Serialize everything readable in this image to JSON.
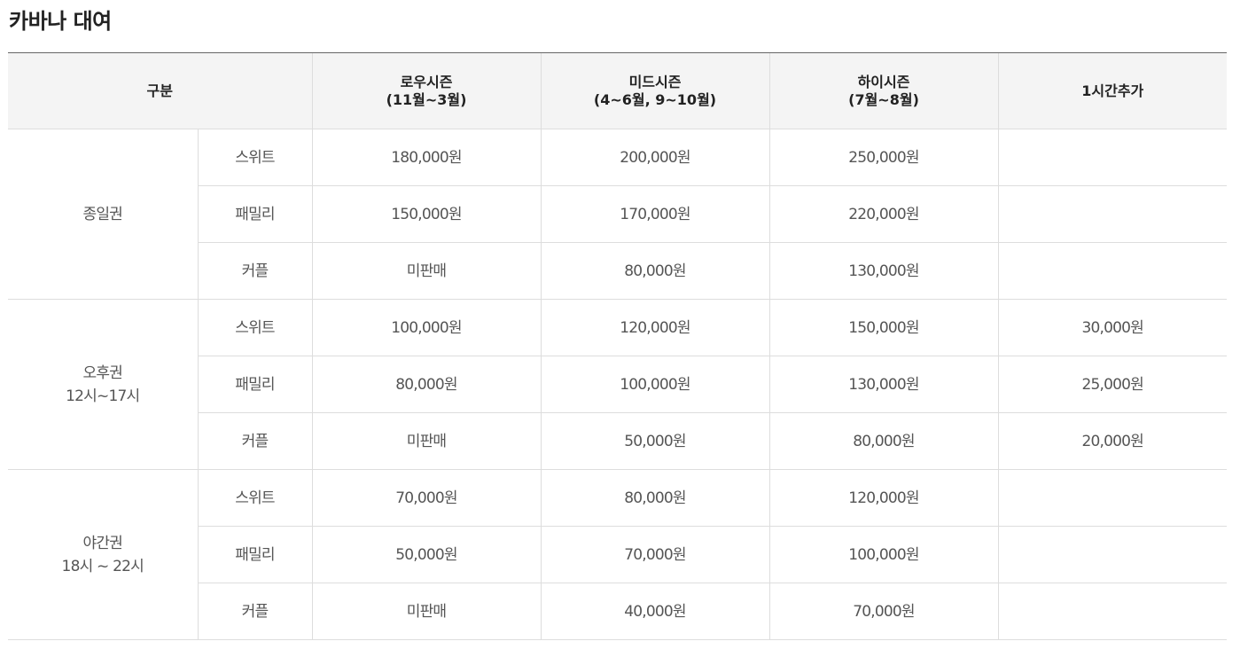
{
  "title": "카바나 대여",
  "headers": {
    "category": "구분",
    "low": {
      "name": "로우시즌",
      "period": "(11월~3월)"
    },
    "mid": {
      "name": "미드시즌",
      "period": "(4~6월, 9~10월)"
    },
    "high": {
      "name": "하이시즌",
      "period": "(7월~8월)"
    },
    "extra": "1시간추가"
  },
  "groups": [
    {
      "name": "종일권",
      "time": "",
      "rows": [
        {
          "type": "스위트",
          "low": "180,000원",
          "mid": "200,000원",
          "high": "250,000원",
          "extra": ""
        },
        {
          "type": "패밀리",
          "low": "150,000원",
          "mid": "170,000원",
          "high": "220,000원",
          "extra": ""
        },
        {
          "type": "커플",
          "low": "미판매",
          "mid": "80,000원",
          "high": "130,000원",
          "extra": ""
        }
      ]
    },
    {
      "name": "오후권",
      "time": "12시~17시",
      "rows": [
        {
          "type": "스위트",
          "low": "100,000원",
          "mid": "120,000원",
          "high": "150,000원",
          "extra": "30,000원"
        },
        {
          "type": "패밀리",
          "low": "80,000원",
          "mid": "100,000원",
          "high": "130,000원",
          "extra": "25,000원"
        },
        {
          "type": "커플",
          "low": "미판매",
          "mid": "50,000원",
          "high": "80,000원",
          "extra": "20,000원"
        }
      ]
    },
    {
      "name": "야간권",
      "time": "18시 ~ 22시",
      "rows": [
        {
          "type": "스위트",
          "low": "70,000원",
          "mid": "80,000원",
          "high": "120,000원",
          "extra": ""
        },
        {
          "type": "패밀리",
          "low": "50,000원",
          "mid": "70,000원",
          "high": "100,000원",
          "extra": ""
        },
        {
          "type": "커플",
          "low": "미판매",
          "mid": "40,000원",
          "high": "70,000원",
          "extra": ""
        }
      ]
    }
  ]
}
